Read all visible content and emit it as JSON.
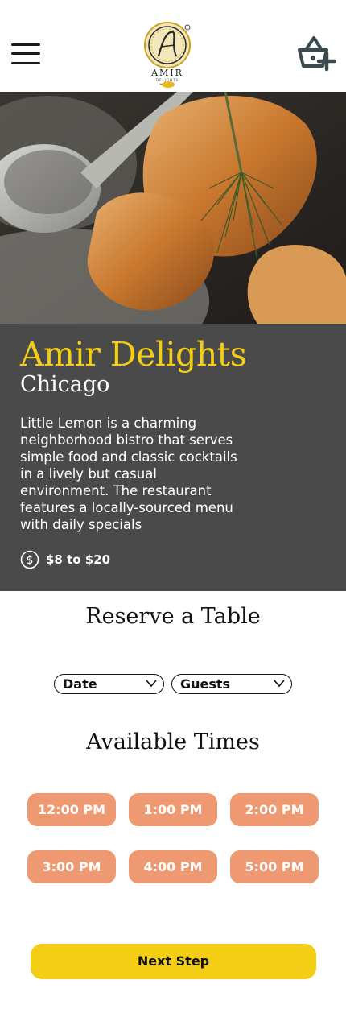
{
  "header": {
    "logo_text": "AMIR",
    "logo_subtext": "DELIGHTS",
    "menu_icon": "hamburger-menu-icon",
    "basket_icon": "basket-add-icon"
  },
  "hero": {
    "image_subject": "roasted fish with dill and a metal spoon in a bowl"
  },
  "restaurant": {
    "name": "Amir Delights",
    "city": "Chicago",
    "description": "Little Lemon is a charming neighborhood bistro that serves simple food and classic cocktails in a lively but casual environment. The restaurant features a locally-sourced menu with daily specials",
    "price_range": "$8 to $20",
    "price_icon": "dollar-circle-icon"
  },
  "reservation": {
    "title": "Reserve a Table",
    "date_select": "Date",
    "guests_select": "Guests",
    "times_title": "Available Times",
    "times": [
      "12:00 PM",
      "1:00 PM",
      "2:00 PM",
      "3:00 PM",
      "4:00 PM",
      "5:00 PM"
    ],
    "next_label": "Next Step"
  },
  "colors": {
    "primary_yellow": "#F4CE14",
    "panel_gray": "#4A4A4A",
    "slot_salmon": "#EE9972"
  }
}
